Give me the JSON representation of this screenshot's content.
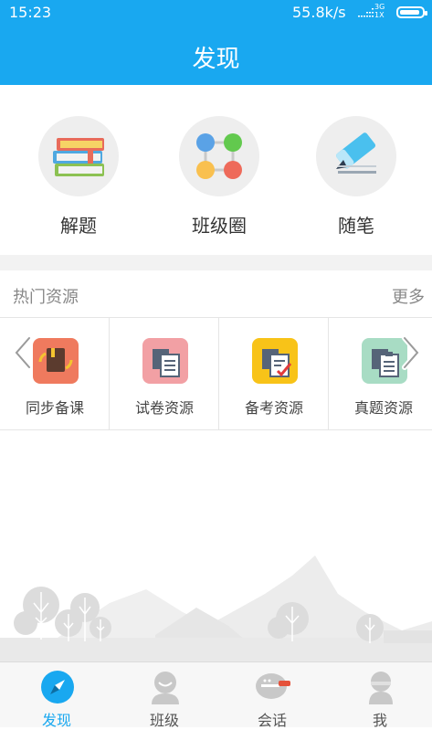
{
  "status_bar": {
    "time": "15:23",
    "speed": "55.8k/s",
    "network_top": "3G",
    "network_bottom": "1X",
    "battery_level": 0.9
  },
  "header": {
    "title": "发现"
  },
  "features": [
    {
      "label": "解题",
      "icon": "books-icon"
    },
    {
      "label": "班级圈",
      "icon": "class-circle-icon"
    },
    {
      "label": "随笔",
      "icon": "eraser-pen-icon"
    }
  ],
  "hot_resources": {
    "title": "热门资源",
    "more_label": "更多",
    "items": [
      {
        "label": "同步备课",
        "icon": "sync-lesson-icon",
        "color": "#ef7a5e"
      },
      {
        "label": "试卷资源",
        "icon": "exam-paper-icon",
        "color": "#f2a0a4"
      },
      {
        "label": "备考资源",
        "icon": "exam-prep-icon",
        "color": "#f8c318"
      },
      {
        "label": "真题资源",
        "icon": "real-questions-icon",
        "color": "#a8dcc4"
      }
    ]
  },
  "tabs": [
    {
      "label": "发现",
      "icon": "compass-icon",
      "active": true
    },
    {
      "label": "班级",
      "icon": "class-icon",
      "active": false
    },
    {
      "label": "会话",
      "icon": "chat-icon",
      "active": false
    },
    {
      "label": "我",
      "icon": "user-icon",
      "active": false
    }
  ],
  "colors": {
    "primary": "#19a8f0",
    "tab_inactive": "#c8c8c8",
    "text": "#333333"
  }
}
